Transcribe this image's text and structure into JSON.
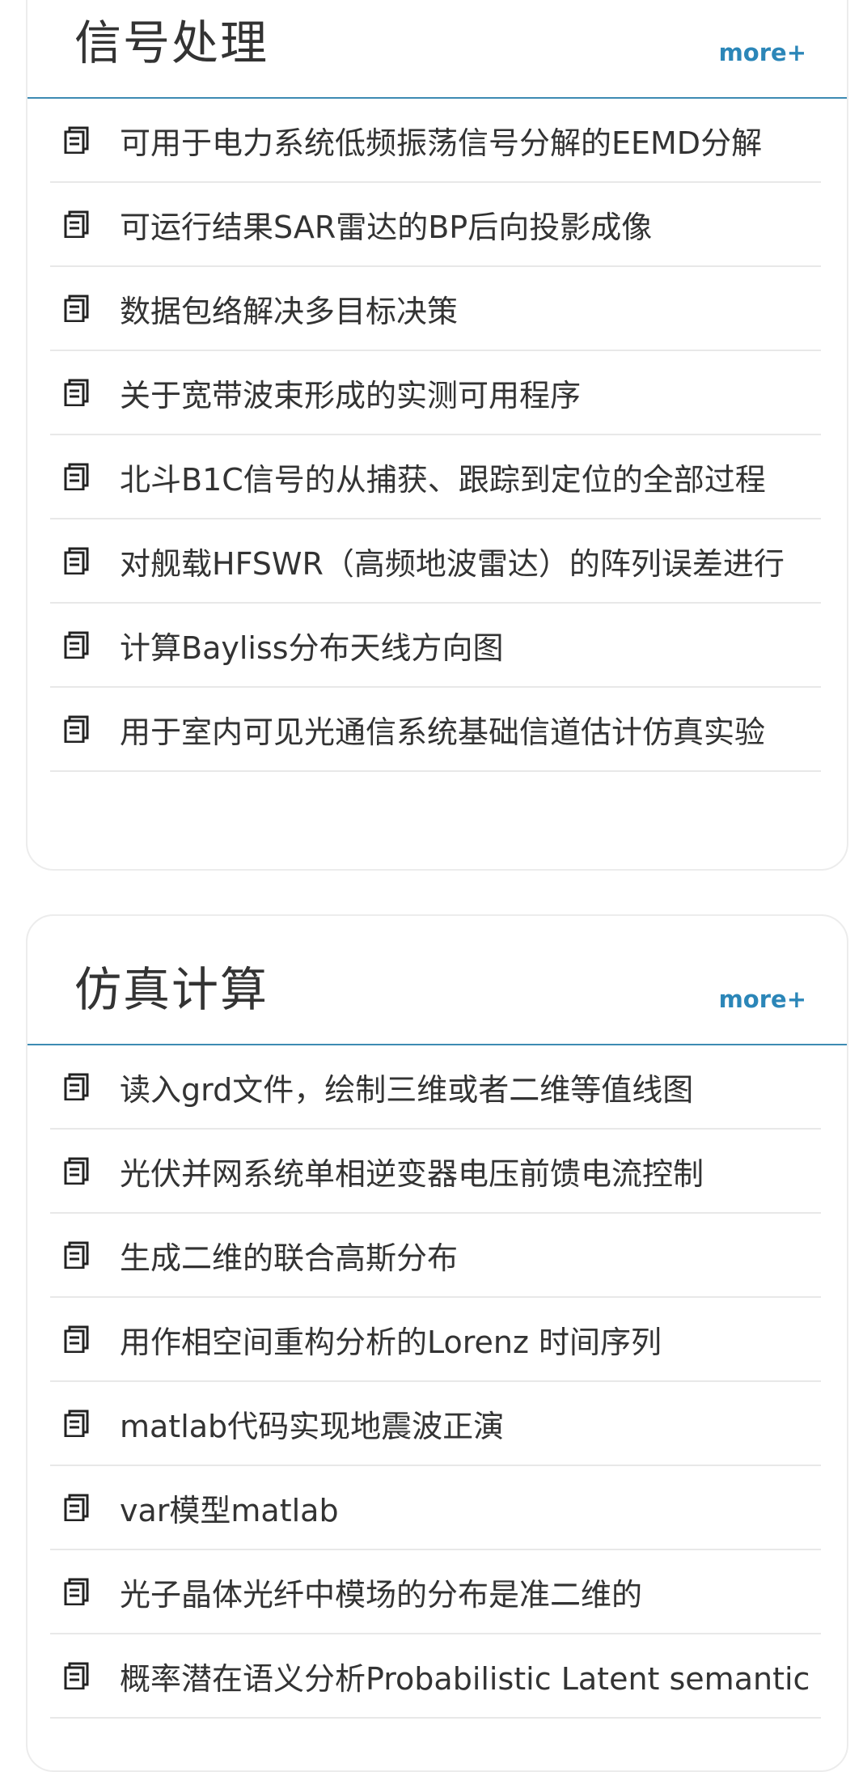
{
  "sections": [
    {
      "title": "信号处理",
      "more_label": "more+",
      "items": [
        "可用于电力系统低频振荡信号分解的EEMD分解",
        "可运行结果SAR雷达的BP后向投影成像",
        "数据包络解决多目标决策",
        "关于宽带波束形成的实测可用程序",
        "北斗B1C信号的从捕获、跟踪到定位的全部过程",
        "对舰载HFSWR（高频地波雷达）的阵列误差进行",
        "计算Bayliss分布天线方向图",
        "用于室内可见光通信系统基础信道估计仿真实验"
      ]
    },
    {
      "title": "仿真计算",
      "more_label": "more+",
      "items": [
        "读入grd文件，绘制三维或者二维等值线图",
        "光伏并网系统单相逆变器电压前馈电流控制",
        "生成二维的联合高斯分布",
        "用作相空间重构分析的Lorenz 时间序列",
        "matlab代码实现地震波正演",
        "var模型matlab",
        "光子晶体光纤中模场的分布是准二维的",
        "概率潜在语义分析Probabilistic Latent semantic"
      ]
    }
  ],
  "icon": "document-icon",
  "colors": {
    "accent": "#2b86b8",
    "header_rule": "#3d8bb3",
    "text": "#333333",
    "divider": "#e8e8e8",
    "card_border": "#ececec"
  }
}
